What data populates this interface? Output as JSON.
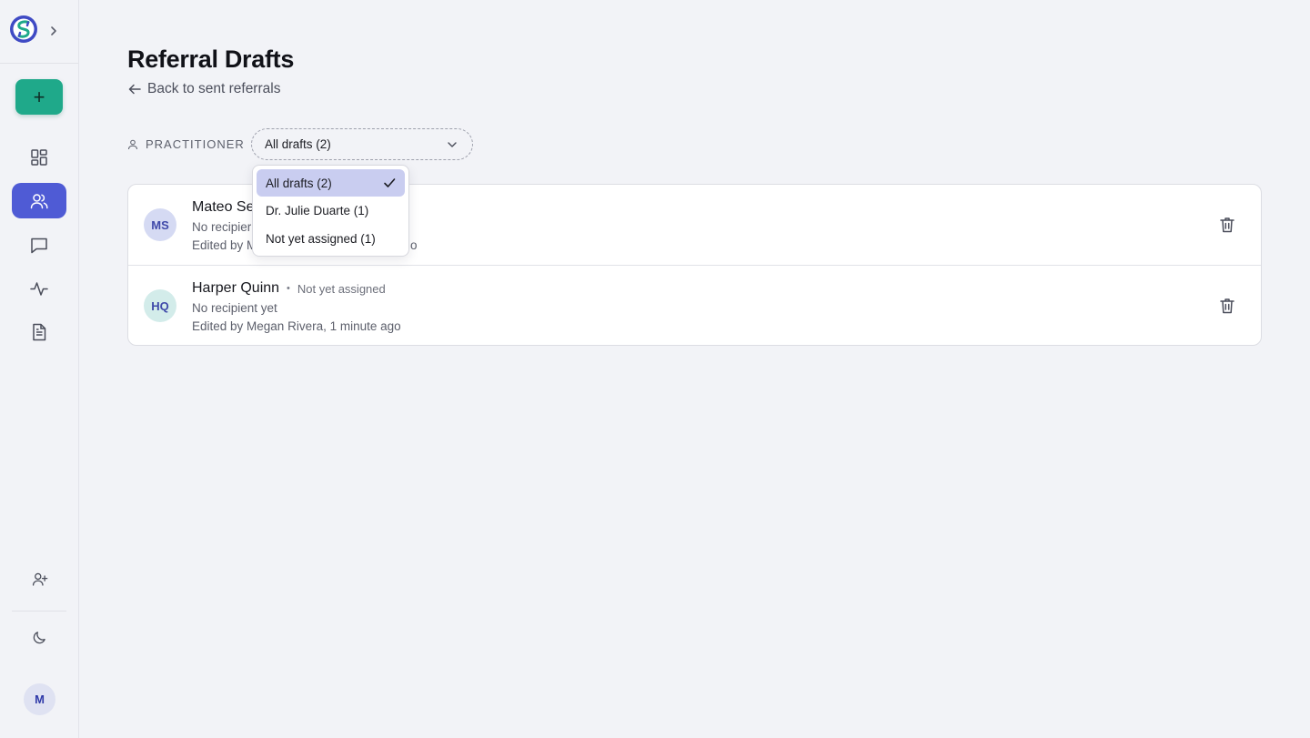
{
  "page": {
    "title": "Referral Drafts",
    "back_link": "Back to sent referrals"
  },
  "sidebar": {
    "new_button": "+",
    "avatar_initial": "M",
    "active_item": "referrals",
    "items": [
      "dashboard",
      "referrals",
      "messages",
      "activity",
      "documents"
    ],
    "bottom_items": [
      "invite-user",
      "dark-mode"
    ]
  },
  "filter": {
    "label": "PRACTITIONER",
    "selected": "All drafts (2)",
    "options": [
      {
        "label": "All drafts (2)",
        "selected": true
      },
      {
        "label": "Dr. Julie Duarte (1)",
        "selected": false
      },
      {
        "label": "Not yet assigned (1)",
        "selected": false
      }
    ]
  },
  "drafts": [
    {
      "initials": "MS",
      "name": "Mateo Se",
      "recipient": "No recipier",
      "edited": "Edited by M",
      "edited_tail": "o",
      "avatar_color": "#d5daf3"
    },
    {
      "initials": "HQ",
      "name": "Harper Quinn",
      "separator": "•",
      "status": "Not yet assigned",
      "recipient": "No recipient yet",
      "edited": "Edited by Megan Rivera, 1 minute ago",
      "avatar_color": "#d3ecea"
    }
  ],
  "colors": {
    "accent": "#4f5bd5",
    "new_button": "#1fa98a",
    "selected_option": "#c9cdf0",
    "background": "#f2f3f7"
  }
}
